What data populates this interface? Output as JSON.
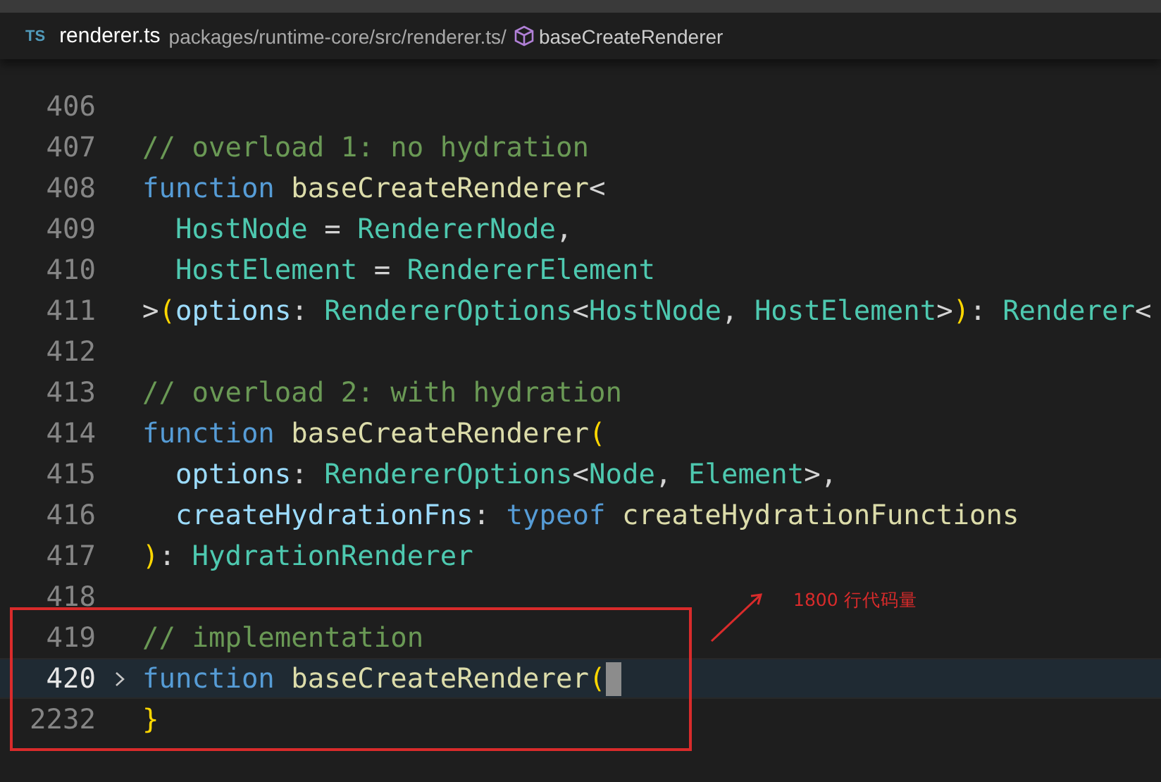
{
  "breadcrumb": {
    "file_badge": "TS",
    "file_name": "renderer.ts",
    "path": "packages/runtime-core/src/renderer.ts/",
    "symbol": "baseCreateRenderer"
  },
  "lines": [
    {
      "number": "406",
      "current": false,
      "foldable": false
    },
    {
      "number": "407",
      "current": false,
      "foldable": false,
      "tokens": [
        {
          "kind": "comment",
          "text": "// overload 1: no hydration"
        }
      ]
    },
    {
      "number": "408",
      "current": false,
      "foldable": false,
      "tokens": [
        {
          "kind": "keyword",
          "text": "function "
        },
        {
          "kind": "function",
          "text": "baseCreateRenderer"
        },
        {
          "kind": "plain",
          "text": "<"
        }
      ]
    },
    {
      "number": "409",
      "current": false,
      "foldable": false,
      "tokens": [
        {
          "kind": "type",
          "text": "  HostNode"
        },
        {
          "kind": "plain",
          "text": " = "
        },
        {
          "kind": "type",
          "text": "RendererNode"
        },
        {
          "kind": "plain",
          "text": ","
        }
      ]
    },
    {
      "number": "410",
      "current": false,
      "foldable": false,
      "tokens": [
        {
          "kind": "type",
          "text": "  HostElement"
        },
        {
          "kind": "plain",
          "text": " = "
        },
        {
          "kind": "type",
          "text": "RendererElement"
        }
      ]
    },
    {
      "number": "411",
      "current": false,
      "foldable": false,
      "tokens": [
        {
          "kind": "plain",
          "text": ">"
        },
        {
          "kind": "bracket",
          "text": "("
        },
        {
          "kind": "param",
          "text": "options"
        },
        {
          "kind": "plain",
          "text": ": "
        },
        {
          "kind": "type",
          "text": "RendererOptions"
        },
        {
          "kind": "plain",
          "text": "<"
        },
        {
          "kind": "type",
          "text": "HostNode"
        },
        {
          "kind": "plain",
          "text": ", "
        },
        {
          "kind": "type",
          "text": "HostElement"
        },
        {
          "kind": "plain",
          "text": ">"
        },
        {
          "kind": "bracket",
          "text": ")"
        },
        {
          "kind": "plain",
          "text": ": "
        },
        {
          "kind": "type",
          "text": "Renderer"
        },
        {
          "kind": "plain",
          "text": "<"
        }
      ]
    },
    {
      "number": "412",
      "current": false,
      "foldable": false
    },
    {
      "number": "413",
      "current": false,
      "foldable": false,
      "tokens": [
        {
          "kind": "comment",
          "text": "// overload 2: with hydration"
        }
      ]
    },
    {
      "number": "414",
      "current": false,
      "foldable": false,
      "tokens": [
        {
          "kind": "keyword",
          "text": "function "
        },
        {
          "kind": "function",
          "text": "baseCreateRenderer"
        },
        {
          "kind": "bracket",
          "text": "("
        }
      ]
    },
    {
      "number": "415",
      "current": false,
      "foldable": false,
      "tokens": [
        {
          "kind": "param",
          "text": "  options"
        },
        {
          "kind": "plain",
          "text": ": "
        },
        {
          "kind": "type",
          "text": "RendererOptions"
        },
        {
          "kind": "plain",
          "text": "<"
        },
        {
          "kind": "type",
          "text": "Node"
        },
        {
          "kind": "plain",
          "text": ", "
        },
        {
          "kind": "type",
          "text": "Element"
        },
        {
          "kind": "plain",
          "text": ">,"
        }
      ]
    },
    {
      "number": "416",
      "current": false,
      "foldable": false,
      "tokens": [
        {
          "kind": "param",
          "text": "  createHydrationFns"
        },
        {
          "kind": "plain",
          "text": ": "
        },
        {
          "kind": "keyword",
          "text": "typeof "
        },
        {
          "kind": "function",
          "text": "createHydrationFunctions"
        }
      ]
    },
    {
      "number": "417",
      "current": false,
      "foldable": false,
      "tokens": [
        {
          "kind": "bracket",
          "text": ")"
        },
        {
          "kind": "plain",
          "text": ": "
        },
        {
          "kind": "type",
          "text": "HydrationRenderer"
        }
      ]
    },
    {
      "number": "418",
      "current": false,
      "foldable": false
    },
    {
      "number": "419",
      "current": false,
      "foldable": false,
      "tokens": [
        {
          "kind": "comment",
          "text": "// implementation"
        }
      ]
    },
    {
      "number": "420",
      "current": true,
      "foldable": true,
      "tokens": [
        {
          "kind": "keyword",
          "text": "function "
        },
        {
          "kind": "function",
          "text": "baseCreateRenderer"
        },
        {
          "kind": "bracket",
          "text": "("
        }
      ]
    },
    {
      "number": "2232",
      "current": false,
      "foldable": false,
      "tokens": [
        {
          "kind": "bracket",
          "text": "}"
        }
      ]
    }
  ],
  "annotation": {
    "text": "1800 行代码量"
  }
}
